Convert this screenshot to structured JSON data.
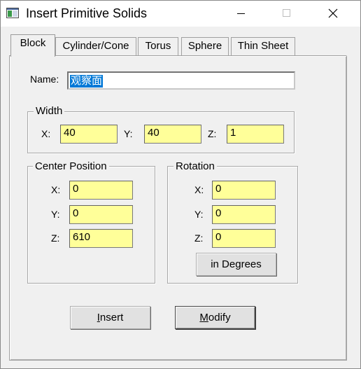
{
  "window": {
    "title": "Insert Primitive Solids"
  },
  "tabs": [
    {
      "label": "Block",
      "active": true
    },
    {
      "label": "Cylinder/Cone",
      "active": false
    },
    {
      "label": "Torus",
      "active": false
    },
    {
      "label": "Sphere",
      "active": false
    },
    {
      "label": "Thin Sheet",
      "active": false
    }
  ],
  "name": {
    "label": "Name:",
    "value": "观察面"
  },
  "width_group": {
    "title": "Width",
    "x_label": "X:",
    "x_value": "40",
    "y_label": "Y:",
    "y_value": "40",
    "z_label": "Z:",
    "z_value": "1"
  },
  "center_group": {
    "title": "Center Position",
    "x_label": "X:",
    "x_value": "0",
    "y_label": "Y:",
    "y_value": "0",
    "z_label": "Z:",
    "z_value": "610"
  },
  "rotation_group": {
    "title": "Rotation",
    "x_label": "X:",
    "x_value": "0",
    "y_label": "Y:",
    "y_value": "0",
    "z_label": "Z:",
    "z_value": "0",
    "degrees_button": "in Degrees"
  },
  "buttons": {
    "insert_mnemonic": "I",
    "insert_rest": "nsert",
    "modify_mnemonic": "M",
    "modify_rest": "odify"
  },
  "colors": {
    "field_bg": "#ffff99",
    "selection": "#0078d7",
    "dialog_bg": "#f0f0f0"
  }
}
